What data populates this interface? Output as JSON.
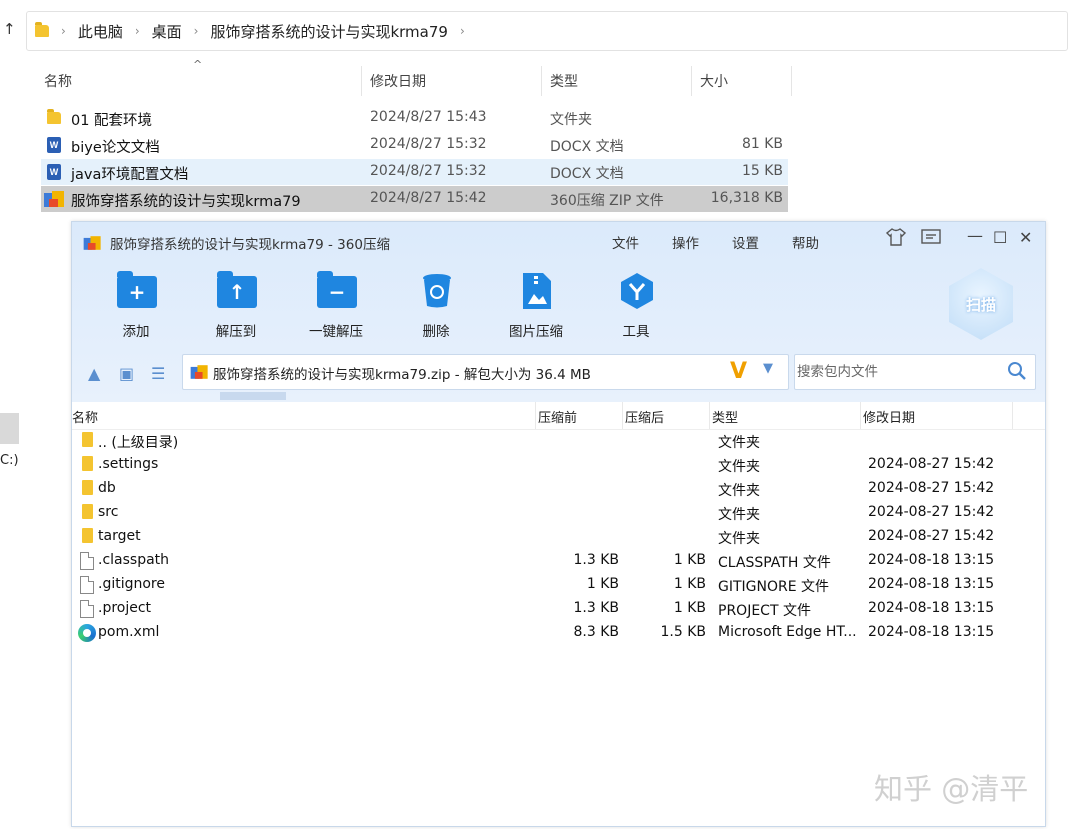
{
  "explorer": {
    "breadcrumb": [
      "此电脑",
      "桌面",
      "服饰穿搭系统的设计与实现krma79"
    ],
    "columns": {
      "name": "名称",
      "modified": "修改日期",
      "type": "类型",
      "size": "大小"
    },
    "rows": [
      {
        "name": "01 配套环境",
        "modified": "2024/8/27 15:43",
        "type": "文件夹",
        "size": "",
        "icon": "folder-icon"
      },
      {
        "name": "biye论文文档",
        "modified": "2024/8/27 15:32",
        "type": "DOCX 文档",
        "size": "81 KB",
        "icon": "word-doc-icon"
      },
      {
        "name": "java环境配置文档",
        "modified": "2024/8/27 15:32",
        "type": "DOCX 文档",
        "size": "15 KB",
        "icon": "word-doc-icon"
      },
      {
        "name": "服饰穿搭系统的设计与实现krma79",
        "modified": "2024/8/27 15:42",
        "type": "360压缩 ZIP 文件",
        "size": "16,318 KB",
        "icon": "zip-archive-icon"
      }
    ],
    "drive_fragment": "C:)"
  },
  "zip_window": {
    "title": "服饰穿搭系统的设计与实现krma79 - 360压缩",
    "menu": [
      "文件",
      "操作",
      "设置",
      "帮助"
    ],
    "toolbar": [
      {
        "label": "添加",
        "icon": "add-folder-icon",
        "sym": "+"
      },
      {
        "label": "解压到",
        "icon": "extract-to-icon",
        "sym": "↑"
      },
      {
        "label": "一键解压",
        "icon": "one-click-extract-icon",
        "sym": "−"
      },
      {
        "label": "删除",
        "icon": "trash-icon"
      },
      {
        "label": "图片压缩",
        "icon": "image-compress-icon"
      },
      {
        "label": "工具",
        "icon": "tools-icon"
      }
    ],
    "scan_label": "扫描",
    "path_text": "服饰穿搭系统的设计与实现krma79.zip - 解包大小为 36.4 MB",
    "search_placeholder": "搜索包内文件",
    "columns": {
      "name": "名称",
      "compressed_before": "压缩前",
      "compressed_after": "压缩后",
      "type": "类型",
      "modified": "修改日期"
    },
    "rows": [
      {
        "name": ".. (上级目录)",
        "before": "",
        "after": "",
        "type": "文件夹",
        "modified": "",
        "icon": "folder-icon"
      },
      {
        "name": ".settings",
        "before": "",
        "after": "",
        "type": "文件夹",
        "modified": "2024-08-27 15:42",
        "icon": "folder-icon"
      },
      {
        "name": "db",
        "before": "",
        "after": "",
        "type": "文件夹",
        "modified": "2024-08-27 15:42",
        "icon": "folder-icon"
      },
      {
        "name": "src",
        "before": "",
        "after": "",
        "type": "文件夹",
        "modified": "2024-08-27 15:42",
        "icon": "folder-icon"
      },
      {
        "name": "target",
        "before": "",
        "after": "",
        "type": "文件夹",
        "modified": "2024-08-27 15:42",
        "icon": "folder-icon"
      },
      {
        "name": ".classpath",
        "before": "1.3 KB",
        "after": "1 KB",
        "type": "CLASSPATH 文件",
        "modified": "2024-08-18 13:15",
        "icon": "file-icon"
      },
      {
        "name": ".gitignore",
        "before": "1 KB",
        "after": "1 KB",
        "type": "GITIGNORE 文件",
        "modified": "2024-08-18 13:15",
        "icon": "file-icon"
      },
      {
        "name": ".project",
        "before": "1.3 KB",
        "after": "1 KB",
        "type": "PROJECT 文件",
        "modified": "2024-08-18 13:15",
        "icon": "file-icon"
      },
      {
        "name": "pom.xml",
        "before": "8.3 KB",
        "after": "1.5 KB",
        "type": "Microsoft Edge HT...",
        "modified": "2024-08-18 13:15",
        "icon": "edge-icon"
      }
    ]
  },
  "watermark": "知乎 @清平",
  "colors": {
    "accent": "#1f86e0",
    "selection": "#cccccc",
    "hover": "#e5f1fb",
    "toolbar_bg": "#dbeafb"
  }
}
